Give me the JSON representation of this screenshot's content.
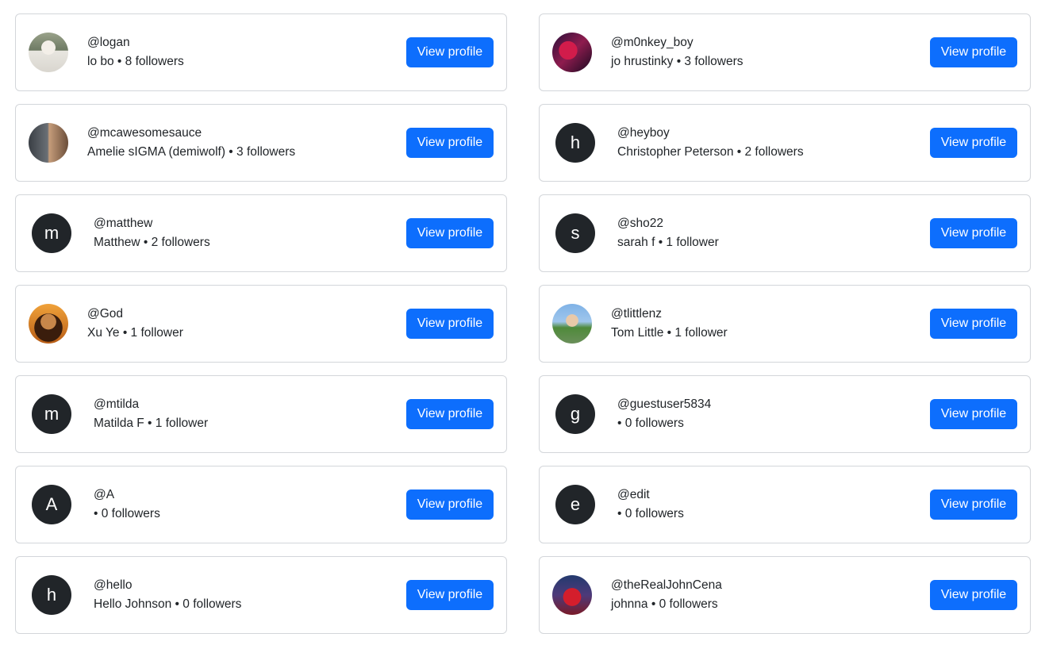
{
  "users": [
    {
      "handle": "@logan",
      "meta": "lo bo • 8 followers",
      "avatar_type": "photo",
      "avatar_style": "ph-cowboy",
      "button": "View profile"
    },
    {
      "handle": "@m0nkey_boy",
      "meta": "jo hrustinky • 3 followers",
      "avatar_type": "photo",
      "avatar_style": "ph-monkey",
      "button": "View profile"
    },
    {
      "handle": "@mcawesomesauce",
      "meta": "Amelie sIGMA (demiwolf) • 3 followers",
      "avatar_type": "photo",
      "avatar_style": "ph-mask",
      "button": "View profile"
    },
    {
      "handle": "@heyboy",
      "meta": "Christopher Peterson • 2 followers",
      "avatar_type": "letter",
      "avatar_letter": "h",
      "button": "View profile"
    },
    {
      "handle": "@matthew",
      "meta": "Matthew • 2 followers",
      "avatar_type": "letter",
      "avatar_letter": "m",
      "button": "View profile"
    },
    {
      "handle": "@sho22",
      "meta": "sarah f • 1 follower",
      "avatar_type": "letter",
      "avatar_letter": "s",
      "button": "View profile"
    },
    {
      "handle": "@God",
      "meta": "Xu Ye • 1 follower",
      "avatar_type": "photo",
      "avatar_style": "ph-god",
      "button": "View profile"
    },
    {
      "handle": "@tlittlenz",
      "meta": "Tom Little • 1 follower",
      "avatar_type": "photo",
      "avatar_style": "ph-tom",
      "button": "View profile"
    },
    {
      "handle": "@mtilda",
      "meta": "Matilda F • 1 follower",
      "avatar_type": "letter",
      "avatar_letter": "m",
      "button": "View profile"
    },
    {
      "handle": "@guestuser5834",
      "meta": " • 0 followers",
      "avatar_type": "letter",
      "avatar_letter": "g",
      "button": "View profile"
    },
    {
      "handle": "@A",
      "meta": " • 0 followers",
      "avatar_type": "letter",
      "avatar_letter": "A",
      "button": "View profile"
    },
    {
      "handle": "@edit",
      "meta": " • 0 followers",
      "avatar_type": "letter",
      "avatar_letter": "e",
      "button": "View profile"
    },
    {
      "handle": "@hello",
      "meta": "Hello Johnson • 0 followers",
      "avatar_type": "letter",
      "avatar_letter": "h",
      "button": "View profile"
    },
    {
      "handle": "@theRealJohnCena",
      "meta": "johnna • 0 followers",
      "avatar_type": "photo",
      "avatar_style": "ph-cena",
      "button": "View profile"
    }
  ],
  "colors": {
    "primary": "#0d6efd",
    "avatar_bg": "#212529",
    "border": "#d3d6da"
  }
}
